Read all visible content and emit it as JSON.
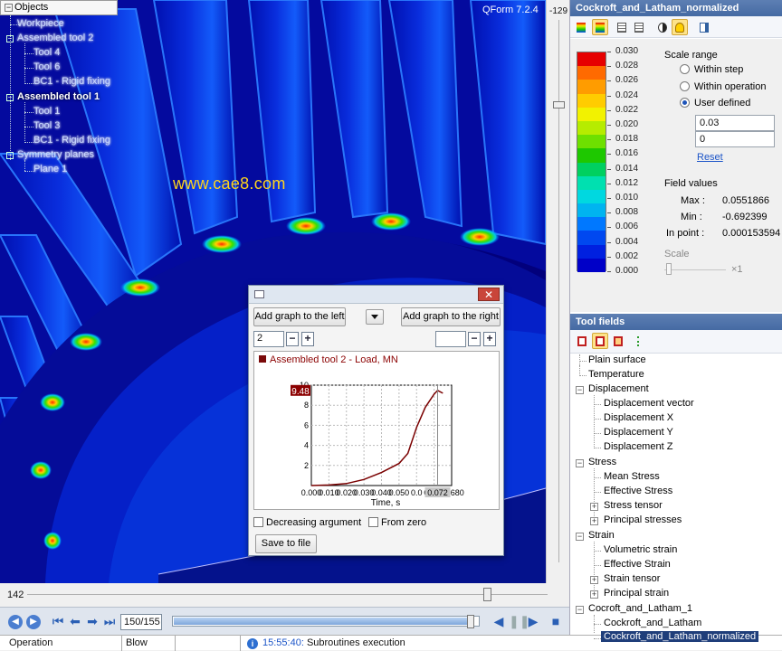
{
  "viewport": {
    "version": "QForm 7.2.4",
    "watermark": "www.cae8.com",
    "objects_header": "Objects",
    "tree": [
      {
        "label": "Workpiece"
      },
      {
        "label": "Assembled tool 2"
      },
      {
        "label": "Tool 4"
      },
      {
        "label": "Tool 6"
      },
      {
        "label": "BC1 - Rigid fixing"
      },
      {
        "label": "Assembled tool 1"
      },
      {
        "label": "Tool 1"
      },
      {
        "label": "Tool 3"
      },
      {
        "label": "BC1 - Rigid fixing"
      },
      {
        "label": "Symmetry planes"
      },
      {
        "label": "Plane 1"
      }
    ],
    "vertical_value": "-129",
    "horizontal_value": "142"
  },
  "dialog": {
    "add_left": "Add graph to the left",
    "add_right": "Add graph to the right",
    "left_count": "2",
    "right_count": "",
    "close": "✕",
    "legend": "Assembled tool 2 - Load, MN",
    "decreasing": "Decreasing argument",
    "from_zero": "From zero",
    "save": "Save to file",
    "minus": "−",
    "plus": "+"
  },
  "chart_data": {
    "type": "line",
    "title": "",
    "xlabel": "Time, s",
    "ylabel": "",
    "x_ticks": [
      "0.000",
      "0.010",
      "0.020",
      "0.030",
      "0.040",
      "0.050",
      "0.0",
      "0.072",
      "0.0680"
    ],
    "y_ticks": [
      "2",
      "4",
      "6",
      "8",
      "10"
    ],
    "xlim": [
      0,
      0.08
    ],
    "ylim": [
      0,
      10
    ],
    "grid": true,
    "marker_label": "9.48",
    "marker_x": "0.072",
    "series": [
      {
        "values": [
          [
            0.0,
            0.0
          ],
          [
            0.01,
            0.05
          ],
          [
            0.02,
            0.2
          ],
          [
            0.03,
            0.6
          ],
          [
            0.04,
            1.3
          ],
          [
            0.05,
            2.2
          ],
          [
            0.055,
            3.2
          ],
          [
            0.06,
            5.8
          ],
          [
            0.065,
            7.8
          ],
          [
            0.07,
            9.1
          ],
          [
            0.072,
            9.48
          ],
          [
            0.075,
            9.2
          ]
        ],
        "color": "#7a0000"
      }
    ]
  },
  "bottom": {
    "frame": "150/155",
    "progress": 0.98,
    "operation_header": "Operation",
    "blow_header": "Blow",
    "log_time": "15:55:40:",
    "log_text": "Subroutines execution"
  },
  "right": {
    "scale_title": "Cockroft_and_Latham_normalized",
    "scale_colors": [
      "#e60000",
      "#ff6a00",
      "#ff9c00",
      "#ffcc00",
      "#f2f200",
      "#b6ec00",
      "#6ee000",
      "#1ec800",
      "#00d060",
      "#00e0b0",
      "#00d8e0",
      "#00b4f0",
      "#0078ff",
      "#0048f0",
      "#0020e0",
      "#0000c8"
    ],
    "scale_values": [
      "0.030",
      "0.028",
      "0.026",
      "0.024",
      "0.022",
      "0.020",
      "0.018",
      "0.016",
      "0.014",
      "0.012",
      "0.010",
      "0.008",
      "0.006",
      "0.004",
      "0.002",
      "0.000"
    ],
    "scale_range_label": "Scale range",
    "within_step": "Within step",
    "within_operation": "Within operation",
    "user_defined": "User defined",
    "max_input": "0.03",
    "min_input": "0",
    "reset": "Reset",
    "field_values": "Field values",
    "max_label": "Max :",
    "max_value": "0.0551866",
    "min_label": "Min :",
    "min_value": "-0.692399",
    "inpoint_label": "In point :",
    "inpoint_value": "0.000153594",
    "scale_label": "Scale",
    "scale_x": "×1",
    "tool_fields_title": "Tool fields",
    "tool_tree": [
      {
        "label": "Plain surface"
      },
      {
        "label": "Temperature"
      },
      {
        "label": "Displacement"
      },
      {
        "label": "Displacement vector"
      },
      {
        "label": "Displacement X"
      },
      {
        "label": "Displacement Y"
      },
      {
        "label": "Displacement Z"
      },
      {
        "label": "Stress"
      },
      {
        "label": "Mean Stress"
      },
      {
        "label": "Effective Stress"
      },
      {
        "label": "Stress tensor"
      },
      {
        "label": "Principal stresses"
      },
      {
        "label": "Strain"
      },
      {
        "label": "Volumetric strain"
      },
      {
        "label": "Effective Strain"
      },
      {
        "label": "Strain tensor"
      },
      {
        "label": "Principal strain"
      },
      {
        "label": "Cocroft_and_Latham_1"
      },
      {
        "label": "Cockroft_and_Latham"
      },
      {
        "label": "Cockroft_and_Latham_normalized"
      }
    ]
  }
}
